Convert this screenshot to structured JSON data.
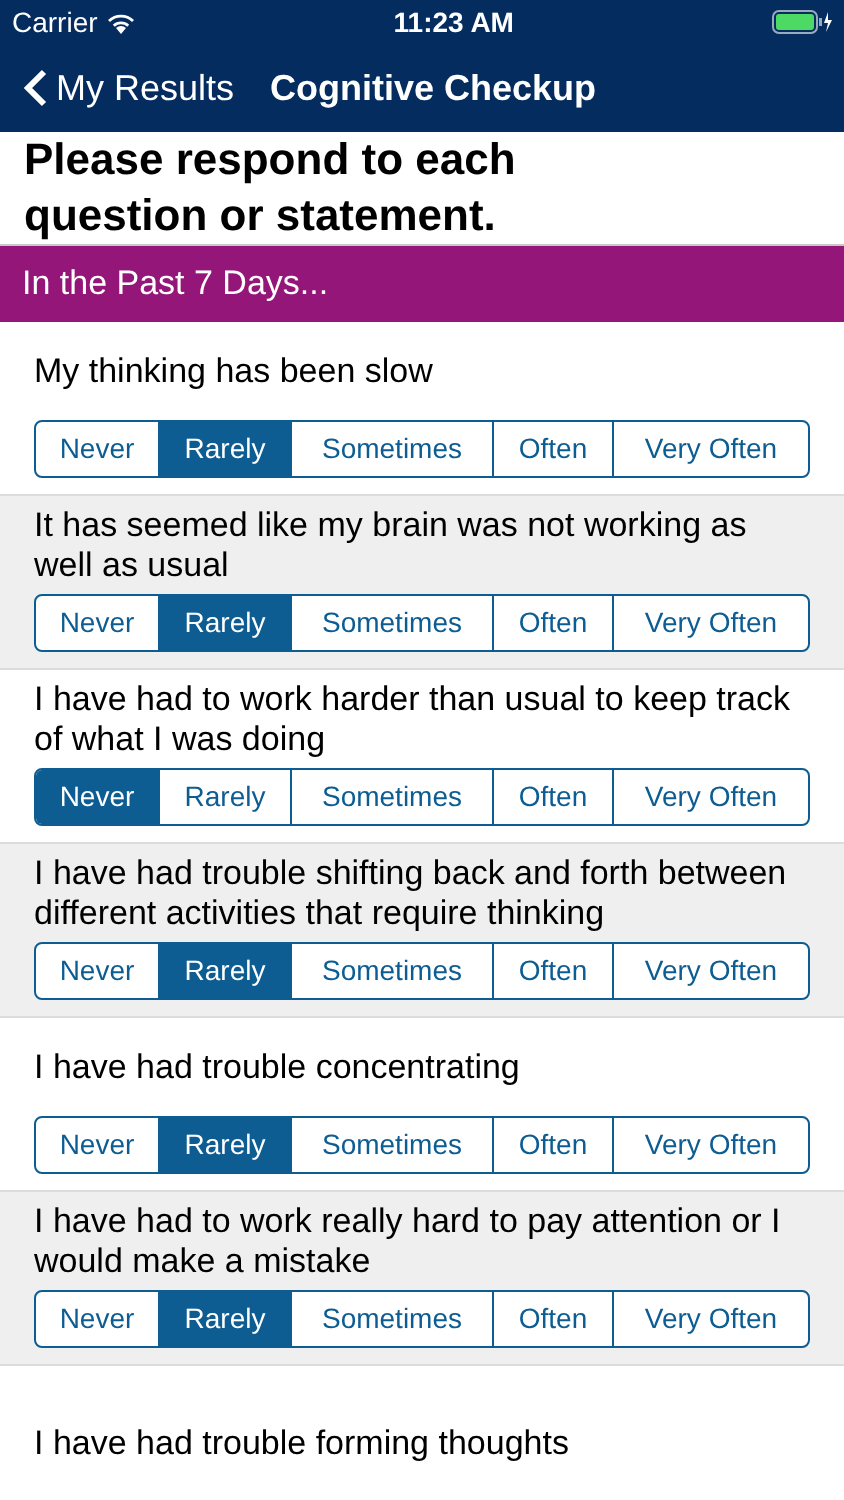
{
  "status_bar": {
    "carrier": "Carrier",
    "time": "11:23 AM",
    "charging": true
  },
  "nav": {
    "back": "My Results",
    "title": "Cognitive Checkup"
  },
  "instruction": "Please respond to each question or statement.",
  "section": "In the Past 7 Days...",
  "questions": [
    {
      "text": "My thinking has been slow",
      "options": [
        {
          "label": "Never",
          "selected": false
        },
        {
          "label": "Rarely",
          "selected": true
        },
        {
          "label": "Sometimes",
          "selected": false
        },
        {
          "label": "Often",
          "selected": false
        },
        {
          "label": "Very Often",
          "selected": false
        }
      ]
    },
    {
      "text": "It has seemed like my brain was not working as well as usual",
      "options": [
        {
          "label": "Never",
          "selected": false
        },
        {
          "label": "Rarely",
          "selected": true
        },
        {
          "label": "Sometimes",
          "selected": false
        },
        {
          "label": "Often",
          "selected": false
        },
        {
          "label": "Very Often",
          "selected": false
        }
      ]
    },
    {
      "text": "I have had to work harder than usual to keep track of what I was doing",
      "options": [
        {
          "label": "Never",
          "selected": true
        },
        {
          "label": "Rarely",
          "selected": false
        },
        {
          "label": "Sometimes",
          "selected": false
        },
        {
          "label": "Often",
          "selected": false
        },
        {
          "label": "Very Often",
          "selected": false
        }
      ]
    },
    {
      "text": "I have had trouble shifting back and forth between different activities that require thinking",
      "options": [
        {
          "label": "Never",
          "selected": false
        },
        {
          "label": "Rarely",
          "selected": true
        },
        {
          "label": "Sometimes",
          "selected": false
        },
        {
          "label": "Often",
          "selected": false
        },
        {
          "label": "Very Often",
          "selected": false
        }
      ]
    },
    {
      "text": "I have had trouble concentrating",
      "options": [
        {
          "label": "Never",
          "selected": false
        },
        {
          "label": "Rarely",
          "selected": true
        },
        {
          "label": "Sometimes",
          "selected": false
        },
        {
          "label": "Often",
          "selected": false
        },
        {
          "label": "Very Often",
          "selected": false
        }
      ]
    },
    {
      "text": "I have had to work really hard to pay attention or I would make a mistake",
      "options": [
        {
          "label": "Never",
          "selected": false
        },
        {
          "label": "Rarely",
          "selected": true
        },
        {
          "label": "Sometimes",
          "selected": false
        },
        {
          "label": "Often",
          "selected": false
        },
        {
          "label": "Very Often",
          "selected": false
        }
      ]
    },
    {
      "text": "I have had trouble forming thoughts"
    }
  ]
}
